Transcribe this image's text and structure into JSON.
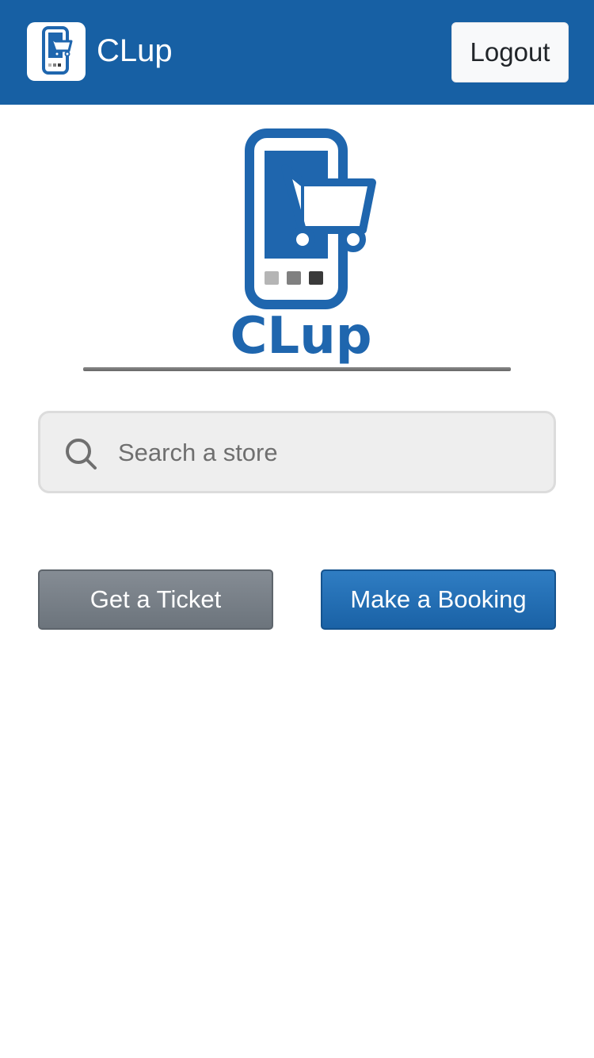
{
  "navbar": {
    "brand_title": "CLup",
    "logout_label": "Logout",
    "brand_color": "#1760a4"
  },
  "hero": {
    "logo_text": "CLup",
    "logo_color": "#1f66ae"
  },
  "search": {
    "placeholder": "Search a store",
    "value": "",
    "icon": "search-icon"
  },
  "actions": {
    "ticket_label": "Get a Ticket",
    "booking_label": "Make a Booking",
    "ticket_color": "#6c747c",
    "booking_color": "#1a62a6"
  }
}
